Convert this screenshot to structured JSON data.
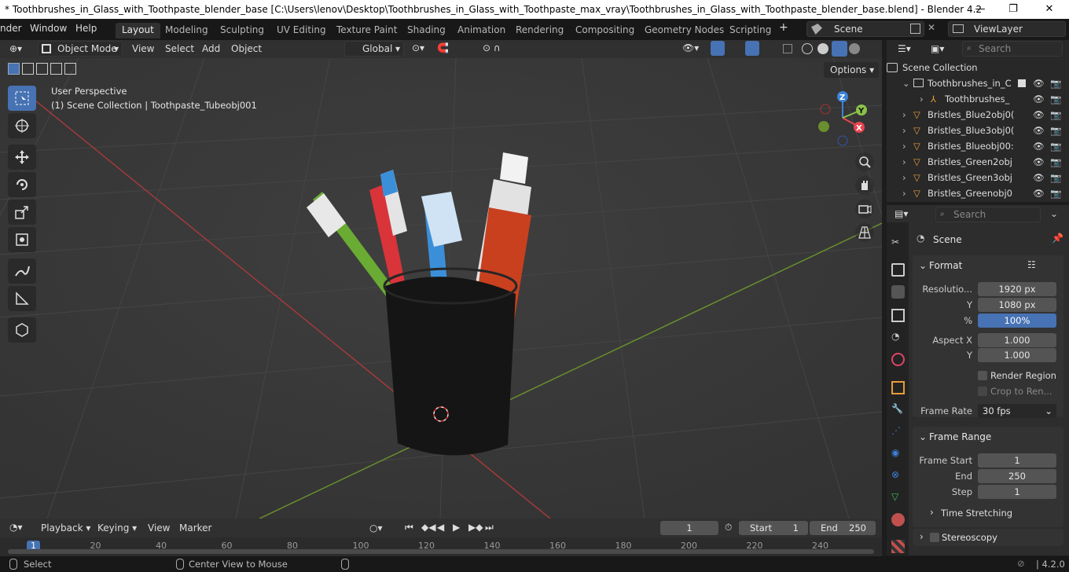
{
  "window": {
    "title": "* Toothbrushes_in_Glass_with_Toothpaste_blender_base [C:\\Users\\lenov\\Desktop\\Toothbrushes_in_Glass_with_Toothpaste_max_vray\\Toothbrushes_in_Glass_with_Toothpaste_blender_base.blend] - Blender 4.2",
    "minimize": "—",
    "maximize": "❐",
    "close": "✕"
  },
  "menu": {
    "render": "nder",
    "window": "Window",
    "help": "Help"
  },
  "workspaces": [
    "Layout",
    "Modeling",
    "Sculpting",
    "UV Editing",
    "Texture Paint",
    "Shading",
    "Animation",
    "Rendering",
    "Compositing",
    "Geometry Nodes",
    "Scripting"
  ],
  "add_workspace": "+",
  "scene": {
    "name": "Scene",
    "view_layer": "ViewLayer"
  },
  "viewport_header": {
    "mode": "Object Mode",
    "view": "View",
    "select": "Select",
    "add": "Add",
    "object": "Object",
    "orientation": "Global",
    "options": "Options"
  },
  "viewport": {
    "perspective": "User Perspective",
    "context": "(1) Scene Collection | Toothpaste_Tubeobj001",
    "axis_x": "X",
    "axis_y": "Y",
    "axis_z": "Z"
  },
  "outliner": {
    "search_placeholder": "Search",
    "root": "Scene Collection",
    "items": [
      "Toothbrushes_in_C",
      "Toothbrushes_",
      "Bristles_Blue2obj0(",
      "Bristles_Blue3obj0(",
      "Bristles_Blueobj00:",
      "Bristles_Green2obj",
      "Bristles_Green3obj",
      "Bristles_Greenobj0"
    ]
  },
  "properties": {
    "search_placeholder": "Search",
    "context": "Scene",
    "format": {
      "title": "Format",
      "res_label": "Resolutio...",
      "res_x": "1920 px",
      "y_label": "Y",
      "res_y": "1080 px",
      "pct_label": "%",
      "pct": "100%",
      "aspect_x_label": "Aspect X",
      "aspect_x": "1.000",
      "aspect_y_label": "Y",
      "aspect_y": "1.000",
      "render_region": "Render Region",
      "crop": "Crop to Ren...",
      "frame_rate_label": "Frame Rate",
      "frame_rate": "30 fps"
    },
    "frame_range": {
      "title": "Frame Range",
      "start_label": "Frame Start",
      "start": "1",
      "end_label": "End",
      "end": "250",
      "step_label": "Step",
      "step": "1"
    },
    "time_stretching": "Time Stretching",
    "stereoscopy": "Stereoscopy"
  },
  "timeline": {
    "playback": "Playback",
    "keying": "Keying",
    "view": "View",
    "marker": "Marker",
    "current": "1",
    "start_label": "Start",
    "start": "1",
    "end_label": "End",
    "end": "250",
    "ticks": [
      "1",
      "20",
      "40",
      "60",
      "80",
      "100",
      "120",
      "140",
      "160",
      "180",
      "200",
      "220",
      "240"
    ]
  },
  "status": {
    "select": "Select",
    "center": "Center View to Mouse",
    "version": "4.2.0"
  },
  "colors": {
    "accent": "#4772b3",
    "axis_x": "#e8454f",
    "axis_y": "#8bc34a",
    "axis_z": "#3b82d9"
  }
}
